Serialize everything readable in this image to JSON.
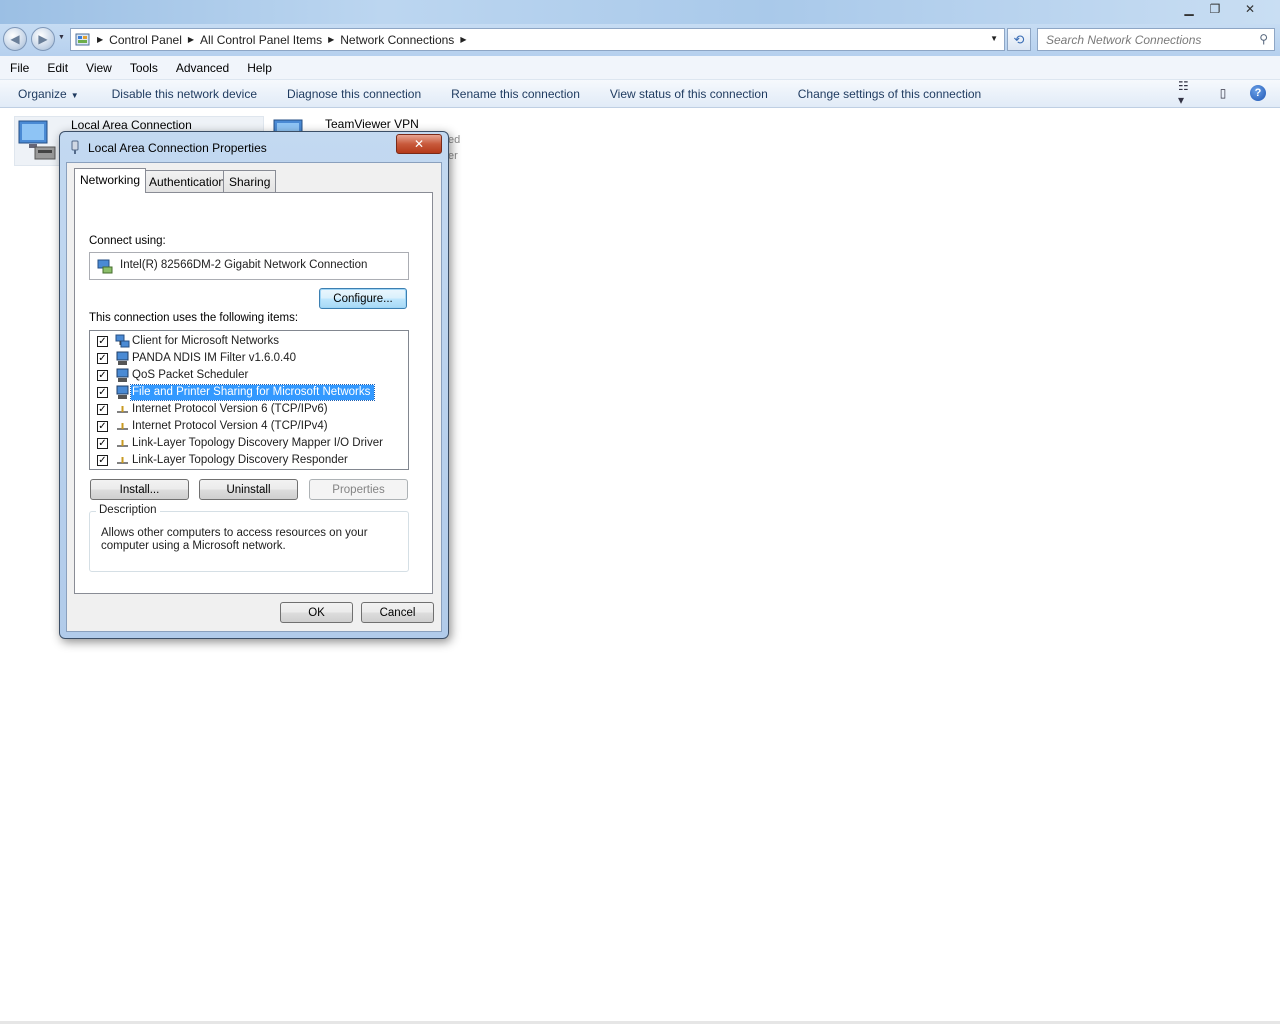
{
  "window": {
    "controls": {
      "minimize": "▁",
      "restore": "❐",
      "close": "✕"
    }
  },
  "navigation": {
    "back_icon": "back-arrow-icon",
    "forward_icon": "forward-arrow-icon",
    "breadcrumbs": [
      "Control Panel",
      "All Control Panel Items",
      "Network Connections"
    ],
    "search_placeholder": "Search Network Connections"
  },
  "menu": [
    "File",
    "Edit",
    "View",
    "Tools",
    "Advanced",
    "Help"
  ],
  "commands": {
    "organize": "Organize",
    "items": [
      "Disable this network device",
      "Diagnose this connection",
      "Rename this connection",
      "View status of this connection",
      "Change settings of this connection"
    ]
  },
  "connections": [
    {
      "name": "Local Area Connection"
    },
    {
      "name": "TeamViewer VPN",
      "partial_status_1": "ed",
      "partial_status_2": "er"
    }
  ],
  "dialog": {
    "title": "Local Area Connection Properties",
    "close_label": "✕",
    "tabs": [
      "Networking",
      "Authentication",
      "Sharing"
    ],
    "active_tab": "Networking",
    "connect_using_label": "Connect using:",
    "adapter": "Intel(R) 82566DM-2 Gigabit Network Connection",
    "configure_button": "Configure...",
    "items_label": "This connection uses the following items:",
    "items": [
      {
        "label": "Client for Microsoft Networks",
        "checked": true,
        "icon": "network-client-icon"
      },
      {
        "label": "PANDA NDIS IM Filter v1.6.0.40",
        "checked": true,
        "icon": "service-icon"
      },
      {
        "label": "QoS Packet Scheduler",
        "checked": true,
        "icon": "service-icon"
      },
      {
        "label": "File and Printer Sharing for Microsoft Networks",
        "checked": true,
        "icon": "service-icon",
        "selected": true
      },
      {
        "label": "Internet Protocol Version 6 (TCP/IPv6)",
        "checked": true,
        "icon": "protocol-icon"
      },
      {
        "label": "Internet Protocol Version 4 (TCP/IPv4)",
        "checked": true,
        "icon": "protocol-icon"
      },
      {
        "label": "Link-Layer Topology Discovery Mapper I/O Driver",
        "checked": true,
        "icon": "protocol-icon"
      },
      {
        "label": "Link-Layer Topology Discovery Responder",
        "checked": true,
        "icon": "protocol-icon"
      }
    ],
    "install_button": "Install...",
    "uninstall_button": "Uninstall",
    "properties_button": "Properties",
    "description_title": "Description",
    "description_text": "Allows other computers to access resources on your computer using a Microsoft network.",
    "ok_button": "OK",
    "cancel_button": "Cancel"
  },
  "colors": {
    "selection": "#3399ff",
    "chrome": "#b6d0ee",
    "close_button": "#c85a3c"
  }
}
